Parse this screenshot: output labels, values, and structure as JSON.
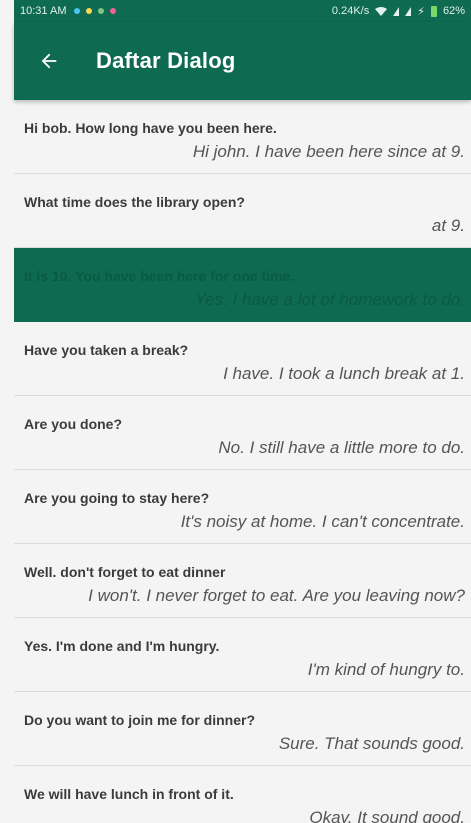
{
  "status_bar": {
    "time": "10:31 AM",
    "network_speed": "0.24K/s",
    "battery": "62%",
    "dot_colors": [
      "#4fc3f7",
      "#ffd54f",
      "#81c784",
      "#f06292"
    ]
  },
  "app_bar": {
    "title": "Daftar Dialog",
    "back_icon": "arrow-left-icon",
    "background": "#0e6a50"
  },
  "dialogs": [
    {
      "q": "Hi bob. How long have you been here.",
      "a": "Hi john. I have been here since at 9."
    },
    {
      "q": "What time does the library open?",
      "a": "at 9."
    },
    {
      "q": "It is 10. You have been here for one time.",
      "a": "Yes. I have a lot of homework to do.",
      "selected": true
    },
    {
      "q": "Have you taken a break?",
      "a": "I have. I took a lunch break at 1."
    },
    {
      "q": "Are you done?",
      "a": "No. I still have a little more to do."
    },
    {
      "q": "Are you going to stay here?",
      "a": "It's noisy at home. I can't concentrate."
    },
    {
      "q": "Well. don't forget to eat dinner",
      "a": "I won't. I never forget to eat. Are you leaving now?"
    },
    {
      "q": "Yes. I'm done and I'm hungry.",
      "a": "I'm kind of hungry to."
    },
    {
      "q": "Do you want to join me for dinner?",
      "a": "Sure. That sounds good."
    },
    {
      "q": "We will have lunch in front of it.",
      "a": "Okay. It sound good."
    }
  ]
}
